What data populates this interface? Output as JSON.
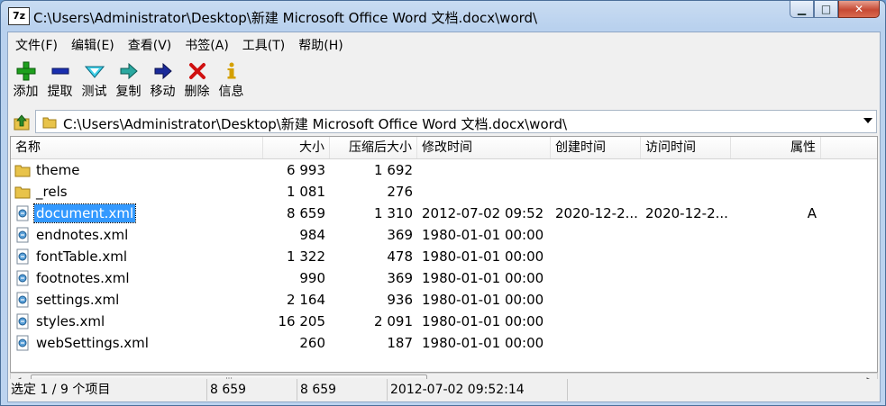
{
  "window": {
    "app_icon_text": "7z",
    "title": "C:\\Users\\Administrator\\Desktop\\新建 Microsoft Office Word 文档.docx\\word\\"
  },
  "menu": [
    "文件(F)",
    "编辑(E)",
    "查看(V)",
    "书签(A)",
    "工具(T)",
    "帮助(H)"
  ],
  "toolbar": [
    {
      "label": "添加",
      "icon": "plus-icon"
    },
    {
      "label": "提取",
      "icon": "minus-icon"
    },
    {
      "label": "测试",
      "icon": "check-icon"
    },
    {
      "label": "复制",
      "icon": "copy-arrow-icon"
    },
    {
      "label": "移动",
      "icon": "move-arrow-icon"
    },
    {
      "label": "删除",
      "icon": "delete-x-icon"
    },
    {
      "label": "信息",
      "icon": "info-icon"
    }
  ],
  "address": {
    "path": "C:\\Users\\Administrator\\Desktop\\新建 Microsoft Office Word 文档.docx\\word\\"
  },
  "columns": {
    "name": "名称",
    "size": "大小",
    "packed": "压缩后大小",
    "modified": "修改时间",
    "created": "创建时间",
    "accessed": "访问时间",
    "attributes": "属性"
  },
  "files": [
    {
      "name": "theme",
      "type": "folder",
      "size": "6 993",
      "packed": "1 692",
      "modified": "",
      "created": "",
      "accessed": "",
      "attr": ""
    },
    {
      "name": "_rels",
      "type": "folder",
      "size": "1 081",
      "packed": "276",
      "modified": "",
      "created": "",
      "accessed": "",
      "attr": ""
    },
    {
      "name": "document.xml",
      "type": "xml",
      "size": "8 659",
      "packed": "1 310",
      "modified": "2012-07-02 09:52",
      "created": "2020-12-2...",
      "accessed": "2020-12-2...",
      "attr": "A",
      "selected": true
    },
    {
      "name": "endnotes.xml",
      "type": "xml",
      "size": "984",
      "packed": "369",
      "modified": "1980-01-01 00:00",
      "created": "",
      "accessed": "",
      "attr": ""
    },
    {
      "name": "fontTable.xml",
      "type": "xml",
      "size": "1 322",
      "packed": "478",
      "modified": "1980-01-01 00:00",
      "created": "",
      "accessed": "",
      "attr": ""
    },
    {
      "name": "footnotes.xml",
      "type": "xml",
      "size": "990",
      "packed": "369",
      "modified": "1980-01-01 00:00",
      "created": "",
      "accessed": "",
      "attr": ""
    },
    {
      "name": "settings.xml",
      "type": "xml",
      "size": "2 164",
      "packed": "936",
      "modified": "1980-01-01 00:00",
      "created": "",
      "accessed": "",
      "attr": ""
    },
    {
      "name": "styles.xml",
      "type": "xml",
      "size": "16 205",
      "packed": "2 091",
      "modified": "1980-01-01 00:00",
      "created": "",
      "accessed": "",
      "attr": ""
    },
    {
      "name": "webSettings.xml",
      "type": "xml",
      "size": "260",
      "packed": "187",
      "modified": "1980-01-01 00:00",
      "created": "",
      "accessed": "",
      "attr": ""
    }
  ],
  "status": {
    "selection": "选定 1 / 9 个项目",
    "size": "8 659",
    "packed": "8 659",
    "modified": "2012-07-02 09:52:14"
  },
  "colors": {
    "selection": "#3399ff",
    "add": "#1ea01e",
    "extract": "#1a2fb0",
    "delete": "#d01010",
    "info": "#d4a000"
  }
}
